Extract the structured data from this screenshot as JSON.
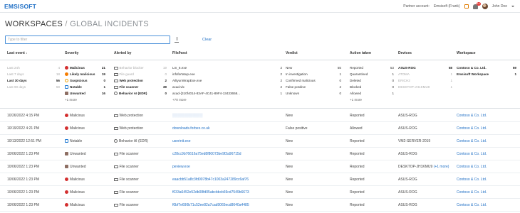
{
  "app": {
    "logo": "EMSISOFT"
  },
  "topbar": {
    "partner_label": "Partner account:",
    "partner_value": "Emsisoft (Frank)",
    "notification_count": "14",
    "user_name": "John Doe"
  },
  "page": {
    "title": "WORKSPACES",
    "separator": "/",
    "subtitle": "GLOBAL INCIDENTS"
  },
  "filter": {
    "placeholder": "Type to filter",
    "clear_label": "Clear"
  },
  "columns": [
    "Last event ↓",
    "Severity",
    "Alerted by",
    "File/host",
    "Verdict",
    "Action taken",
    "Devices",
    "Workspace"
  ],
  "aggregates": {
    "last_event": [
      {
        "label": "Last 24h",
        "count": "4"
      },
      {
        "label": "Last 7 days",
        "count": "18"
      },
      {
        "label": "Last 30 days",
        "count": "56"
      },
      {
        "label": "Last 90 days",
        "count": "59"
      }
    ],
    "severity": [
      {
        "label": "Malicious",
        "count": "21",
        "icon": "malicious-icon"
      },
      {
        "label": "Likely malicious",
        "count": "19",
        "icon": "likely-malicious-icon"
      },
      {
        "label": "Suspicious",
        "count": "0",
        "icon": "suspicious-icon"
      },
      {
        "label": "Notable",
        "count": "1",
        "icon": "notable-icon"
      },
      {
        "label": "Unwanted",
        "count": "16",
        "icon": "unwanted-icon"
      }
    ],
    "severity_more": "+1 more",
    "alerted_by": [
      {
        "label": "Behavior blocker",
        "count": "19",
        "dim": true
      },
      {
        "label": "File guard",
        "count": "0",
        "dim": true
      },
      {
        "label": "Web protection",
        "count": "2",
        "dim": false
      },
      {
        "label": "File scanner",
        "count": "38",
        "dim": false
      },
      {
        "label": "Behavior AI (EDR)",
        "count": "0",
        "dim": false
      }
    ],
    "file_host": [
      {
        "label": "Lm_6.exe",
        "count": "2"
      },
      {
        "label": "infofortatup.exe",
        "count": "2"
      },
      {
        "label": "AiltyunWrapExe.exe",
        "count": "2"
      },
      {
        "label": "acad.vlx",
        "count": "2"
      },
      {
        "label": "acad-{310f4014-83AF-4C41-89F4-13433658...",
        "count": "1"
      }
    ],
    "file_host_more": "+70 more",
    "verdict": [
      {
        "label": "New",
        "count": "55"
      },
      {
        "label": "In investigation",
        "count": "1"
      },
      {
        "label": "Confirmed malicious",
        "count": "0"
      },
      {
        "label": "False positive",
        "count": "2"
      },
      {
        "label": "Unknown",
        "count": "0"
      }
    ],
    "action_taken": [
      {
        "label": "Reported",
        "count": "53",
        "dim": false
      },
      {
        "label": "Quarantined",
        "count": "1",
        "dim": false
      },
      {
        "label": "Deleted",
        "count": "0",
        "dim": false
      },
      {
        "label": "Blocked",
        "count": "0",
        "dim": false
      },
      {
        "label": "Allowed",
        "count": "1",
        "dim": false
      }
    ],
    "action_more": "+1 more",
    "devices": [
      {
        "label": "ASUS-ROG",
        "count": "58",
        "dim": false
      },
      {
        "label": "ATOMA",
        "count": "1",
        "dim": true
      },
      {
        "label": "ERICH2",
        "count": "1",
        "dim": true
      },
      {
        "label": "DESKTOP-JH1KMU9",
        "count": "1",
        "dim": true
      }
    ],
    "workspace": [
      {
        "label": "Contoso & Co. Ltd.",
        "count": "59"
      },
      {
        "label": "Emsisoft Workspace",
        "count": "1"
      }
    ]
  },
  "rows": [
    {
      "date": "10/26/2022 4:15 PM",
      "severity": "Malicious",
      "sev_icon": "malicious-icon",
      "alerted": "Web protection",
      "file": "▒▒▒▒▒▒▒▒▒▒▒▒",
      "verdict": "New",
      "action": "Reported",
      "device": "ASUS-ROG",
      "device_more": "",
      "workspace": "Contoso & Co. Ltd."
    },
    {
      "date": "10/19/2022 4:21 PM",
      "severity": "Malicious",
      "sev_icon": "malicious-icon",
      "alerted": "Web protection",
      "file": "downloads.forbex.co.uk",
      "verdict": "False positive",
      "action": "Allowed",
      "device": "ASUS-ROG",
      "device_more": "",
      "workspace": "Contoso & Co. Ltd."
    },
    {
      "date": "10/13/2022 12:51 PM",
      "severity": "Notable",
      "sev_icon": "notable-icon",
      "alerted": "Behavior AI (EDR)",
      "file": "userinit.exe",
      "verdict": "New",
      "action": "Reported",
      "device": "VM2-SERVER-2019",
      "device_more": "",
      "workspace": "Contoso & Co. Ltd."
    },
    {
      "date": "10/06/2022 1:23 PM",
      "severity": "Unwanted",
      "sev_icon": "unwanted-icon",
      "alerted": "File scanner",
      "file": "c28cc9b76616a75ed8f80073be9f2a96715d",
      "verdict": "New",
      "action": "Reported",
      "device": "ASUS-ROG",
      "device_more": "",
      "workspace": "Contoso & Co. Ltd."
    },
    {
      "date": "10/06/2022 1:23 PM",
      "severity": "Unwanted",
      "sev_icon": "unwanted-icon",
      "alerted": "File scanner",
      "file": "peview.exe",
      "verdict": "New",
      "action": "Reported",
      "device": "DESKTOP-JH1KMU9",
      "device_more": "(+1 more)",
      "workspace": "Contoso & Co. Ltd."
    },
    {
      "date": "10/06/2022 1:23 PM",
      "severity": "Malicious",
      "sev_icon": "malicious-icon",
      "alerted": "File scanner",
      "file": "eaacbb51a8c3fd0078b47c1003a247289cc6af76",
      "verdict": "New",
      "action": "Reported",
      "device": "ASUS-ROG",
      "device_more": "",
      "workspace": "Contoso & Co. Ltd."
    },
    {
      "date": "10/06/2022 1:23 PM",
      "severity": "Malicious",
      "sev_icon": "malicious-icon",
      "alerted": "File scanner",
      "file": "f033a6452e52db08fd05abcbbcb69cd7549b6673",
      "verdict": "New",
      "action": "Reported",
      "device": "ASUS-ROG",
      "device_more": "",
      "workspace": "Contoso & Co. Ltd."
    },
    {
      "date": "10/06/2022 1:23 PM",
      "severity": "Malicious",
      "sev_icon": "malicious-icon",
      "alerted": "File scanner",
      "file": "f0bf7e690b71c52ee82a7cad9065ecd8640a4485",
      "verdict": "New",
      "action": "Reported",
      "device": "ASUS-ROG",
      "device_more": "",
      "workspace": "Contoso & Co. Ltd."
    }
  ],
  "colors": {
    "accent": "#1f6fc5",
    "malicious": "#d32f2f",
    "likely_malicious": "#f57c00",
    "suspicious": "#f0a000",
    "notable": "#1976d2",
    "unwanted": "#8d6e63"
  }
}
